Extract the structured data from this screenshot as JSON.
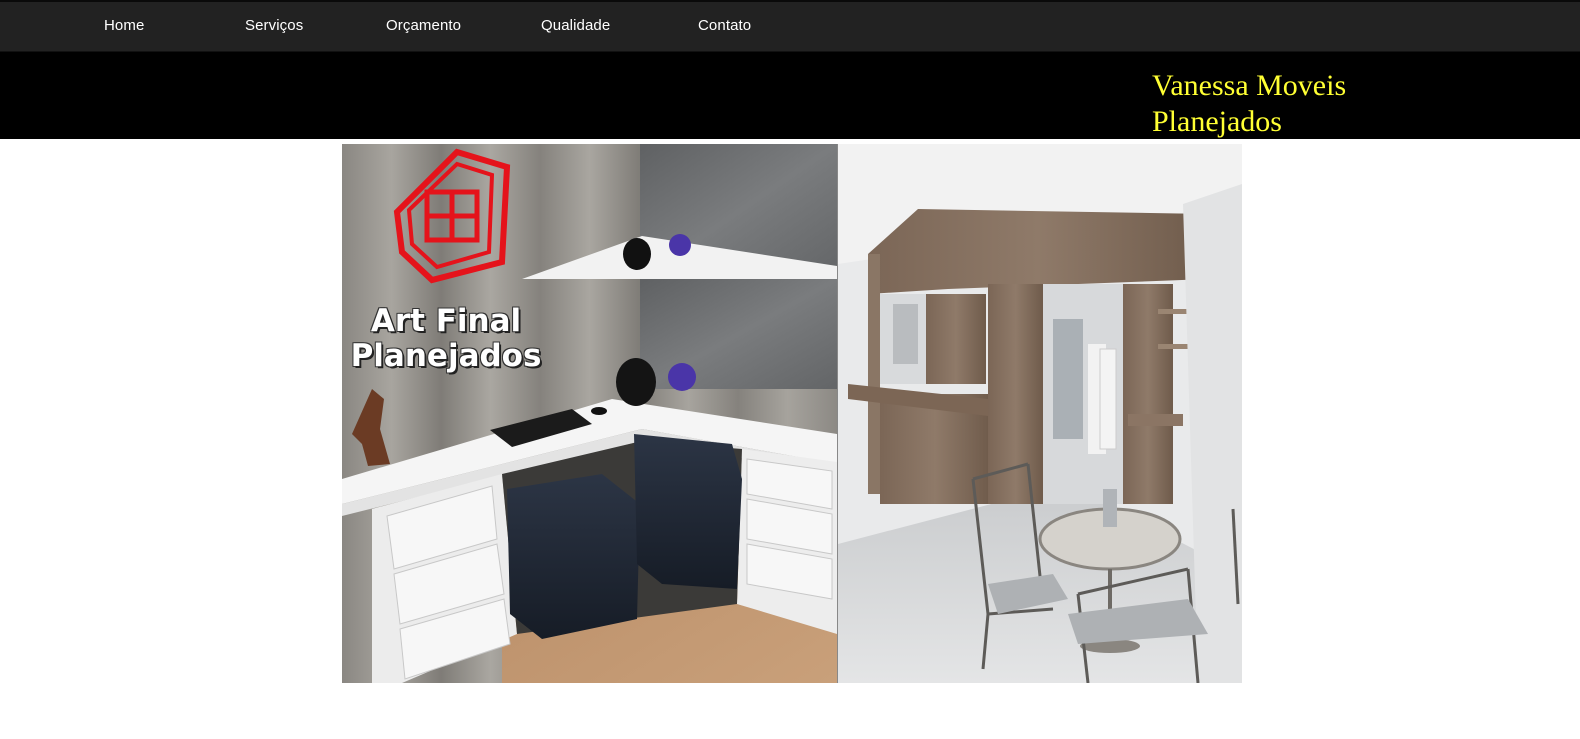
{
  "nav": {
    "items": [
      {
        "label": "Home"
      },
      {
        "label": "Serviços"
      },
      {
        "label": "Orçamento"
      },
      {
        "label": "Qualidade"
      },
      {
        "label": "Contato"
      }
    ]
  },
  "header": {
    "title": "Vanessa Moveis Planejados",
    "title_color": "#ffff33"
  },
  "hero": {
    "logo_line1": "Art Final",
    "logo_line2": "Planejados",
    "logo_color": "#e5131b"
  }
}
